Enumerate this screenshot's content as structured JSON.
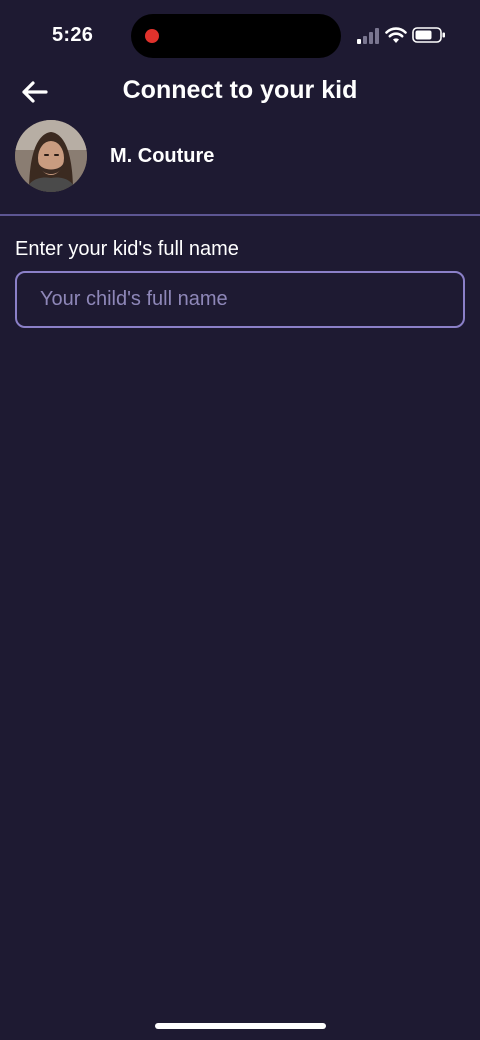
{
  "status_bar": {
    "time": "5:26",
    "recording_color": "#e0322c",
    "icons": [
      "signal-icon",
      "wifi-icon",
      "battery-icon"
    ]
  },
  "header": {
    "title": "Connect to your kid",
    "back_icon": "arrow-left-icon"
  },
  "profile": {
    "name": "M. Couture",
    "avatar": "avatar-photo"
  },
  "form": {
    "label": "Enter your kid's full name",
    "input_value": "",
    "input_placeholder": "Your child's full name"
  },
  "colors": {
    "background": "#1e1a32",
    "divider": "#5d5693",
    "input_border": "#8b80c8",
    "placeholder": "#8e87b8"
  }
}
